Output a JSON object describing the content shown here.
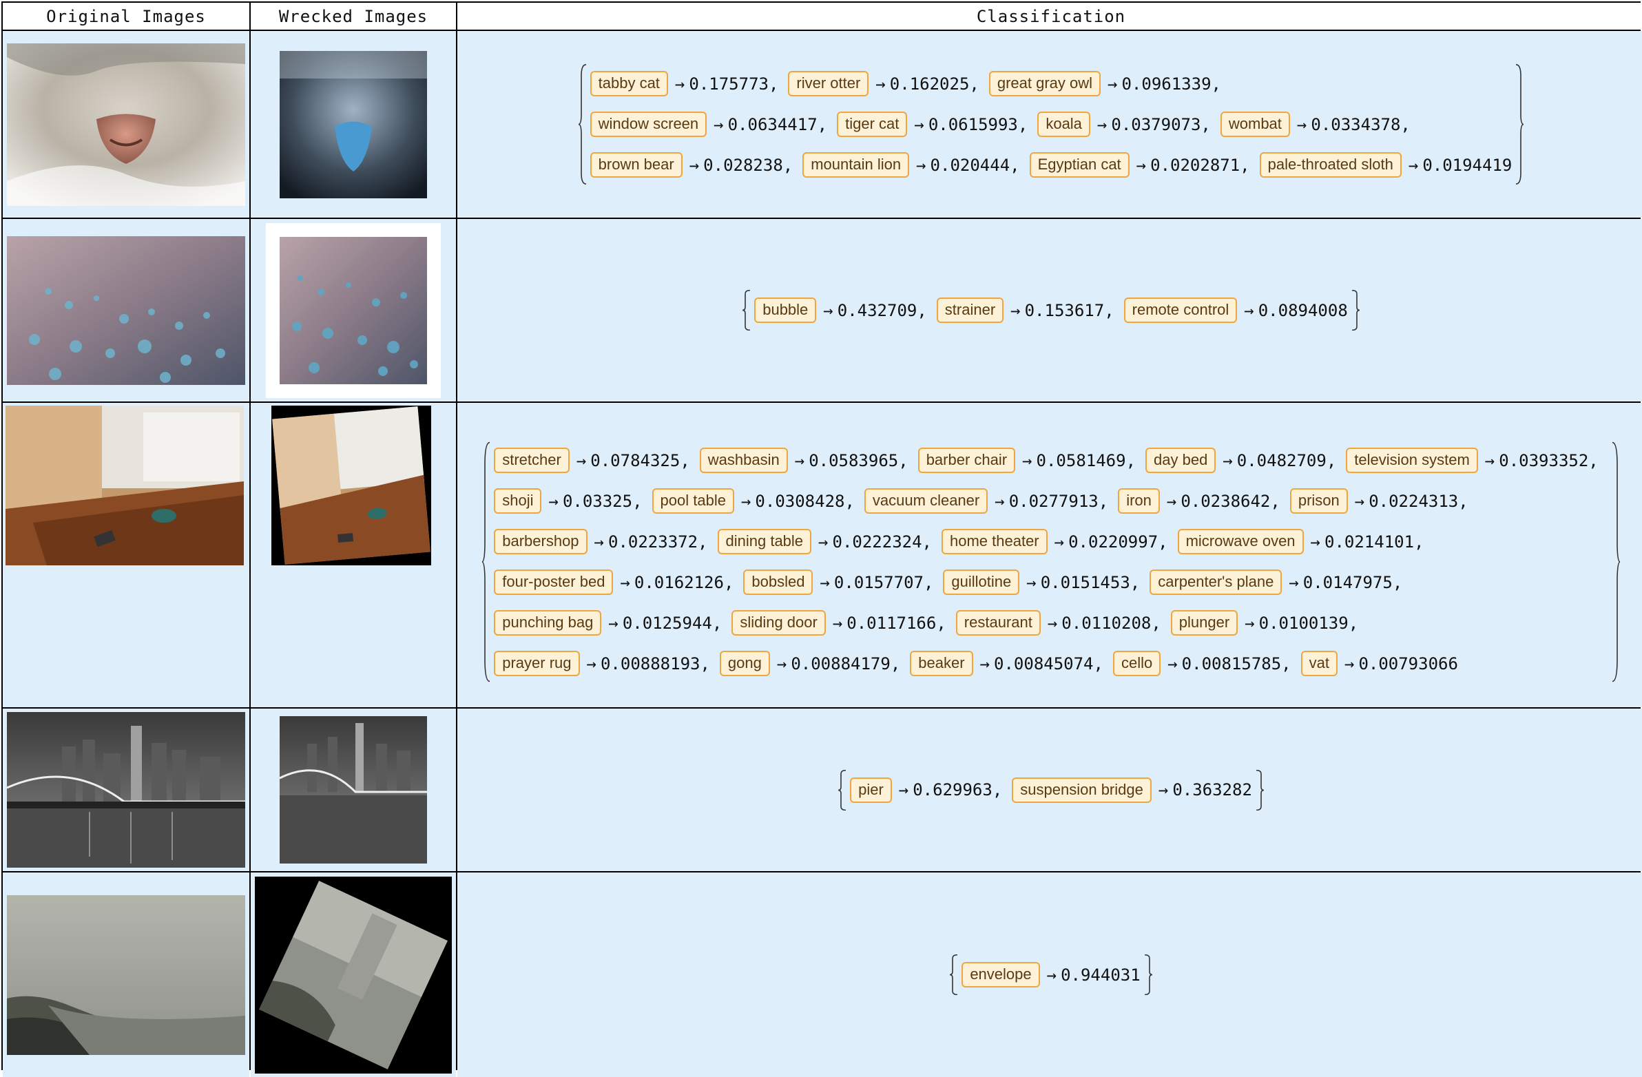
{
  "headers": [
    "Original Images",
    "Wrecked Images",
    "Classification"
  ],
  "rows": [
    {
      "original": "cat-nose-photo",
      "wrecked": "cat-nose-wrecked-photo",
      "classes": [
        [
          [
            "tabby cat",
            "0.175773"
          ],
          [
            "river otter",
            "0.162025"
          ],
          [
            "great gray owl",
            "0.0961339"
          ]
        ],
        [
          [
            "window screen",
            "0.0634417"
          ],
          [
            "tiger cat",
            "0.0615993"
          ],
          [
            "koala",
            "0.0379073"
          ],
          [
            "wombat",
            "0.0334378"
          ]
        ],
        [
          [
            "brown bear",
            "0.028238"
          ],
          [
            "mountain lion",
            "0.020444"
          ],
          [
            "Egyptian cat",
            "0.0202871"
          ],
          [
            "pale-throated sloth",
            "0.0194419"
          ]
        ]
      ]
    },
    {
      "original": "water-drops-photo",
      "wrecked": "water-drops-wrecked-photo",
      "classes": [
        [
          [
            "bubble",
            "0.432709"
          ],
          [
            "strainer",
            "0.153617"
          ],
          [
            "remote control",
            "0.0894008"
          ]
        ]
      ]
    },
    {
      "original": "cafe-table-photo",
      "wrecked": "cafe-table-wrecked-photo",
      "classes": [
        [
          [
            "stretcher",
            "0.0784325"
          ],
          [
            "washbasin",
            "0.0583965"
          ],
          [
            "barber chair",
            "0.0581469"
          ],
          [
            "day bed",
            "0.0482709"
          ],
          [
            "television system",
            "0.0393352"
          ]
        ],
        [
          [
            "shoji",
            "0.03325"
          ],
          [
            "pool table",
            "0.0308428"
          ],
          [
            "vacuum cleaner",
            "0.0277913"
          ],
          [
            "iron",
            "0.0238642"
          ],
          [
            "prison",
            "0.0224313"
          ]
        ],
        [
          [
            "barbershop",
            "0.0223372"
          ],
          [
            "dining table",
            "0.0222324"
          ],
          [
            "home theater",
            "0.0220997"
          ],
          [
            "microwave oven",
            "0.0214101"
          ]
        ],
        [
          [
            "four-poster bed",
            "0.0162126"
          ],
          [
            "bobsled",
            "0.0157707"
          ],
          [
            "guillotine",
            "0.0151453"
          ],
          [
            "carpenter's plane",
            "0.0147975"
          ]
        ],
        [
          [
            "punching bag",
            "0.0125944"
          ],
          [
            "sliding door",
            "0.0117166"
          ],
          [
            "restaurant",
            "0.0110208"
          ],
          [
            "plunger",
            "0.0100139"
          ]
        ],
        [
          [
            "prayer rug",
            "0.00888193"
          ],
          [
            "gong",
            "0.00884179"
          ],
          [
            "beaker",
            "0.00845074"
          ],
          [
            "cello",
            "0.00815785"
          ],
          [
            "vat",
            "0.00793066"
          ]
        ]
      ]
    },
    {
      "original": "bridge-night-photo",
      "wrecked": "bridge-night-wrecked-photo",
      "classes": [
        [
          [
            "pier",
            "0.629963"
          ],
          [
            "suspension bridge",
            "0.363282"
          ]
        ]
      ]
    },
    {
      "original": "foggy-beach-photo",
      "wrecked": "foggy-beach-wrecked-photo",
      "classes": [
        [
          [
            "envelope",
            "0.944031"
          ]
        ]
      ]
    }
  ],
  "arrow_symbol": "→",
  "separator": ","
}
